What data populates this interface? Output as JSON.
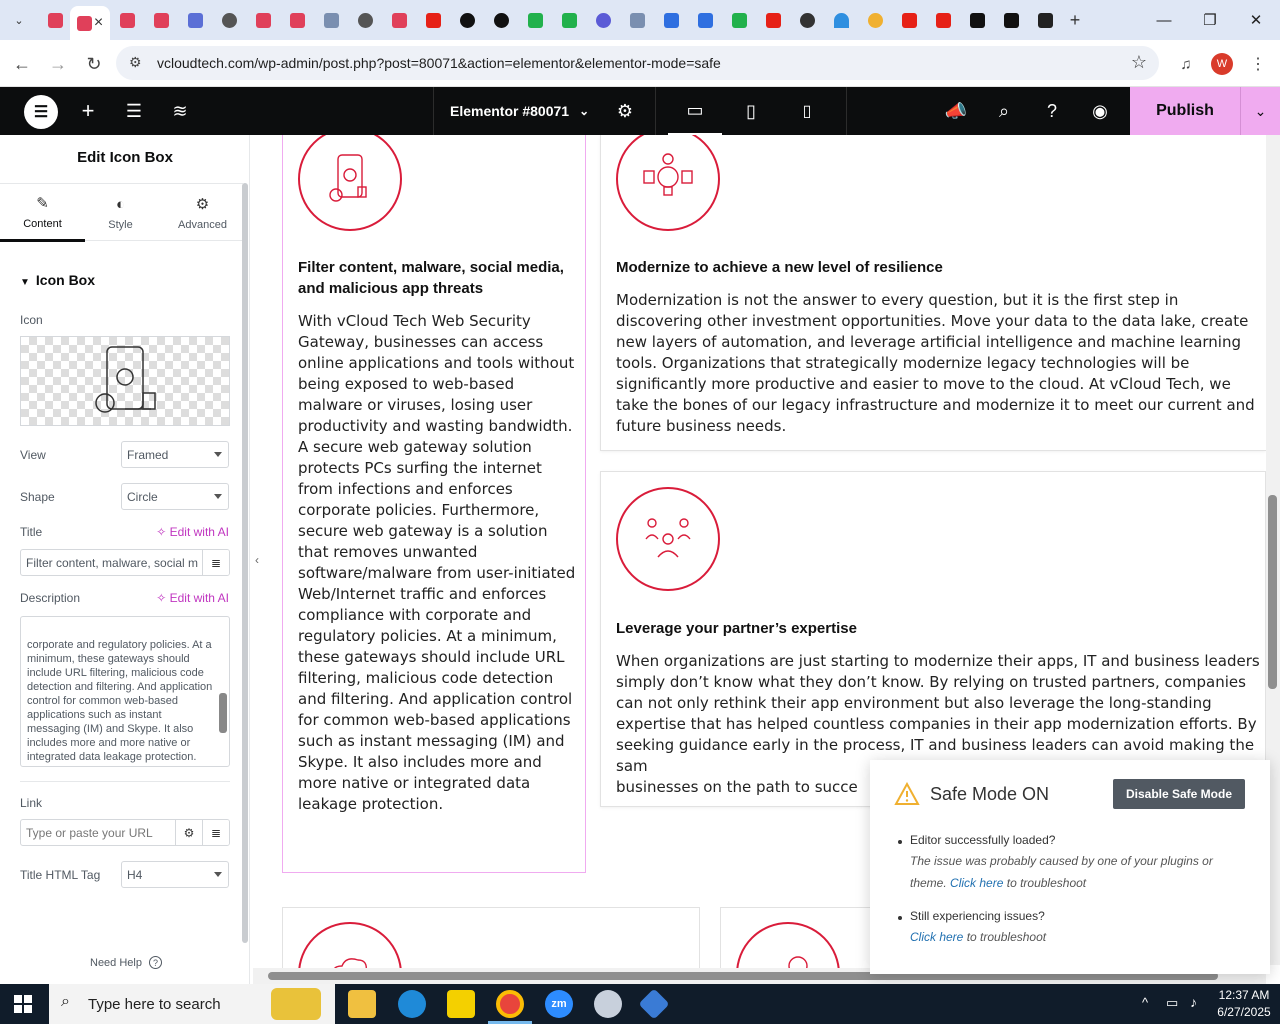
{
  "browser": {
    "url": "vcloudtech.com/wp-admin/post.php?post=80071&action=elementor&elementor-mode=safe",
    "profile_initial": "W"
  },
  "editor": {
    "document_title": "Elementor #80071",
    "publish_label": "Publish"
  },
  "panel": {
    "title": "Edit Icon Box",
    "tabs": [
      "Content",
      "Style",
      "Advanced"
    ],
    "section_title": "Icon Box",
    "icon_label": "Icon",
    "view_label": "View",
    "view_value": "Framed",
    "shape_label": "Shape",
    "shape_value": "Circle",
    "title_label": "Title",
    "edit_ai": "Edit with AI",
    "title_value": "Filter content, malware, social m",
    "description_label": "Description",
    "description_text": "corporate and regulatory policies. At a minimum, these gateways should include URL filtering, malicious code detection and filtering. And application control for common web-based applications such as instant messaging (IM) and Skype. It also includes more and more native or integrated data leakage protection.",
    "link_label": "Link",
    "link_placeholder": "Type or paste your URL",
    "html_tag_label": "Title HTML Tag",
    "html_tag_value": "H4",
    "need_help": "Need Help"
  },
  "cards": {
    "filter": {
      "title": "Filter content, malware, social media, and malicious app threats",
      "text": "With vCloud Tech Web Security Gateway, businesses can access online applications and tools without being exposed to web-based malware or viruses, losing user productivity and wasting bandwidth. A secure web gateway solution protects PCs surfing the internet from infections and enforces corporate policies. Furthermore, secure web gateway is a solution that removes unwanted software/malware from user-initiated Web/Internet traffic and enforces compliance with corporate and regulatory policies. At a minimum, these gateways should include URL filtering, malicious code detection and filtering. And application control for common web-based applications such as instant messaging (IM) and Skype. It also includes more and more native or integrated data leakage protection."
    },
    "modernize": {
      "title": "Modernize to achieve a new level of resilience",
      "text": "Modernization is not the answer to every question, but it is the first step in discovering other investment opportunities. Move your data to the data lake, create new layers of automation, and leverage artificial intelligence and machine learning tools. Organizations that strategically modernize legacy technologies will be significantly more productive and easier to move to the cloud. At vCloud Tech, we take the bones of our legacy infrastructure and modernize it to meet our current and future business needs."
    },
    "partner": {
      "title": "Leverage your partner’s expertise",
      "text": "When organizations are just starting to modernize their apps, IT and business leaders simply don’t know what they don’t know. By relying on trusted partners, companies can not only rethink their app environment but also leverage the long-standing expertise that has helped countless companies in their app modernization efforts. By seeking guidance early in the process, IT and business leaders can avoid making the sam",
      "text_last": "businesses on the path to succe"
    }
  },
  "safe_mode": {
    "title": "Safe Mode ON",
    "button": "Disable Safe Mode",
    "q1": "Editor successfully loaded?",
    "a1_pre": "The issue was probably caused by one of your plugins or theme.",
    "a1_link": "Click here",
    "a1_post": "to troubleshoot",
    "q2": "Still experiencing issues?",
    "a2_link": "Click here",
    "a2_post": "to troubleshoot"
  },
  "taskbar": {
    "search_placeholder": "Type here to search",
    "time": "12:37 AM",
    "date": "6/27/2025"
  },
  "colors": {
    "accent_red": "#d91c3a",
    "elementor_pink": "#f0abf0",
    "link_blue": "#2271b1"
  }
}
